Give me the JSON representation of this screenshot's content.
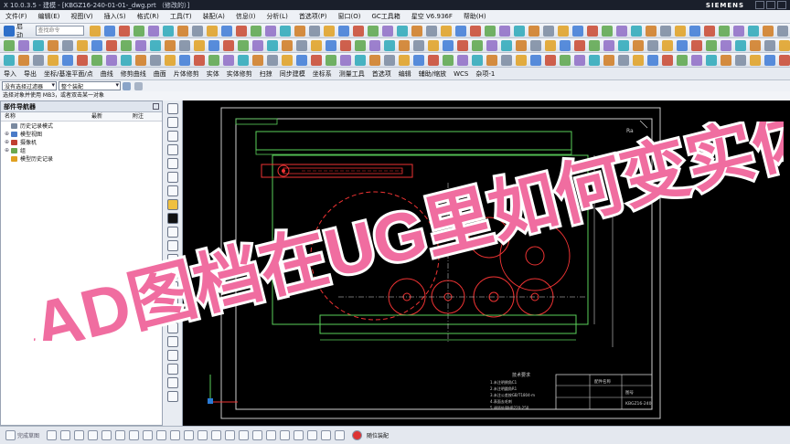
{
  "window": {
    "title": "X 10.0.3.5 - 建模 - [KBGZ16-240-01-01-_dwg.prt （修改的）]",
    "brand": "SIEMENS"
  },
  "menubar": [
    "文件(F)",
    "编辑(E)",
    "视图(V)",
    "插入(S)",
    "格式(R)",
    "工具(T)",
    "装配(A)",
    "信息(I)",
    "分析(L)",
    "首选项(P)",
    "窗口(O)",
    "GC工具箱",
    "星空 V6.936F",
    "帮助(H)"
  ],
  "toolbar": {
    "start_label": "启动",
    "search_placeholder": "查找命令"
  },
  "menu2": [
    "导入",
    "导出",
    "坐标/基准平面/点",
    "曲线",
    "修剪曲线",
    "曲面",
    "片体修剪",
    "实体",
    "实体修剪",
    "扫掠",
    "同步建模",
    "坐标系",
    "测量工具",
    "首选项",
    "编辑",
    "辅助/缩放",
    "WCS",
    "杂项-1"
  ],
  "filter": {
    "selection_filter": "没有选择过滤器",
    "assembly_scope": "整个装配"
  },
  "status_hint": "选择对象并使用 MB3，或者双击某一对象",
  "navigator": {
    "title": "部件导航器",
    "columns": [
      "名称",
      "最新",
      "附注"
    ],
    "rows": [
      {
        "label": "历史记录模式",
        "expander": "",
        "icon_color": "#7a8aa0"
      },
      {
        "label": "模型视图",
        "expander": "⊕",
        "icon_color": "#4a7bc8"
      },
      {
        "label": "摄像机",
        "expander": "⊕",
        "icon_color": "#c04030"
      },
      {
        "label": "组",
        "expander": "⊕",
        "icon_color": "#6aa84f"
      },
      {
        "label": "模型历史记录",
        "expander": "",
        "icon_color": "#e0a020"
      }
    ]
  },
  "overlay": {
    "headline": "CAD图档在UG里如何变实体",
    "color": "#f06da0"
  },
  "drawing": {
    "note_label": "Ra",
    "notes_title": "技术要求",
    "notes": [
      "1.未注明倒角C1",
      "2.未注明圆角R1",
      "3.未注公差按GB/T1804-m",
      "4.表面去毛刺",
      "5.调质处理HB220-250"
    ],
    "titleblock": [
      "配件名称",
      "图号",
      "KBGZ16-240"
    ]
  },
  "bottombar": {
    "label": "完成草图",
    "assembly_label": "随位装配"
  }
}
